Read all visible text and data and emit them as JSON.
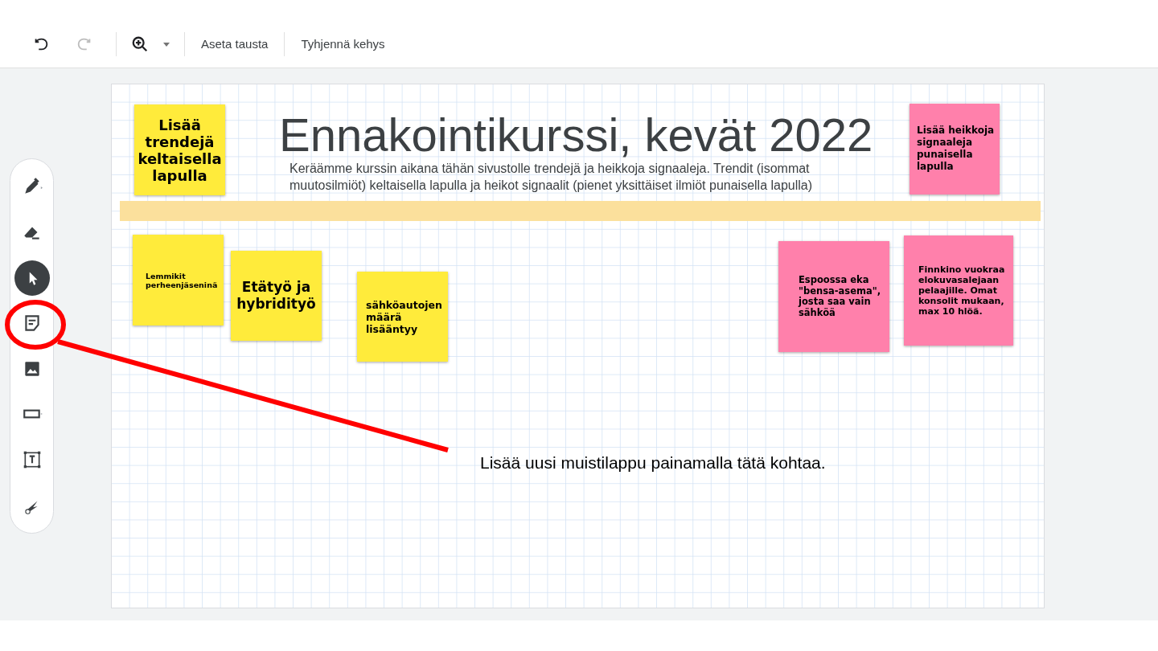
{
  "toolbar": {
    "history": [
      {
        "kind": "undo",
        "disabled": false
      },
      {
        "kind": "redo",
        "disabled": true
      }
    ],
    "buttons": [
      "Aseta tausta",
      "Tyhjennä kehys"
    ]
  },
  "tools": [
    {
      "kind": "pen",
      "selected": false
    },
    {
      "kind": "eraser",
      "selected": false
    },
    {
      "kind": "select",
      "selected": true
    },
    {
      "kind": "note",
      "selected": false
    },
    {
      "kind": "image",
      "selected": false
    },
    {
      "kind": "shape",
      "selected": false
    },
    {
      "kind": "textbox",
      "selected": false
    },
    {
      "kind": "laser",
      "selected": false
    }
  ],
  "frame": {
    "title": "Ennakointikurssi, kevät 2022",
    "subtitle": "Keräämme kurssin aikana tähän sivustolle trendejä ja heikkoja signaaleja. Trendit (isommat muutosilmiöt) keltaisella lapulla ja heikot signaalit (pienet yksittäiset ilmiöt punaisella lapulla)",
    "notes": [
      {
        "text": "Lisää trendejä keltaisella lapulla",
        "color": "#ffeb3b"
      },
      {
        "text": "Lemmikit perheenjäseninä",
        "color": "#ffeb3b"
      },
      {
        "text": "Etätyö ja hybridityö",
        "color": "#ffeb3b"
      },
      {
        "text": "sähköautojen määrä lisääntyy",
        "color": "#ffeb3b"
      },
      {
        "text": "Lisää heikkoja signaaleja punaisella lapulla",
        "color": "#ff80ab"
      },
      {
        "text": "Espoossa eka \"bensa-asema\", josta saa vain sähköä",
        "color": "#ff80ab"
      },
      {
        "text": "Finnkino vuokraa elokuvasalejaan pelaajille. Omat konsolit mukaan, max 10 hlöä.",
        "color": "#ff80ab"
      }
    ]
  },
  "annotation": {
    "text": "Lisää uusi muistilappu painamalla tätä kohtaa."
  }
}
